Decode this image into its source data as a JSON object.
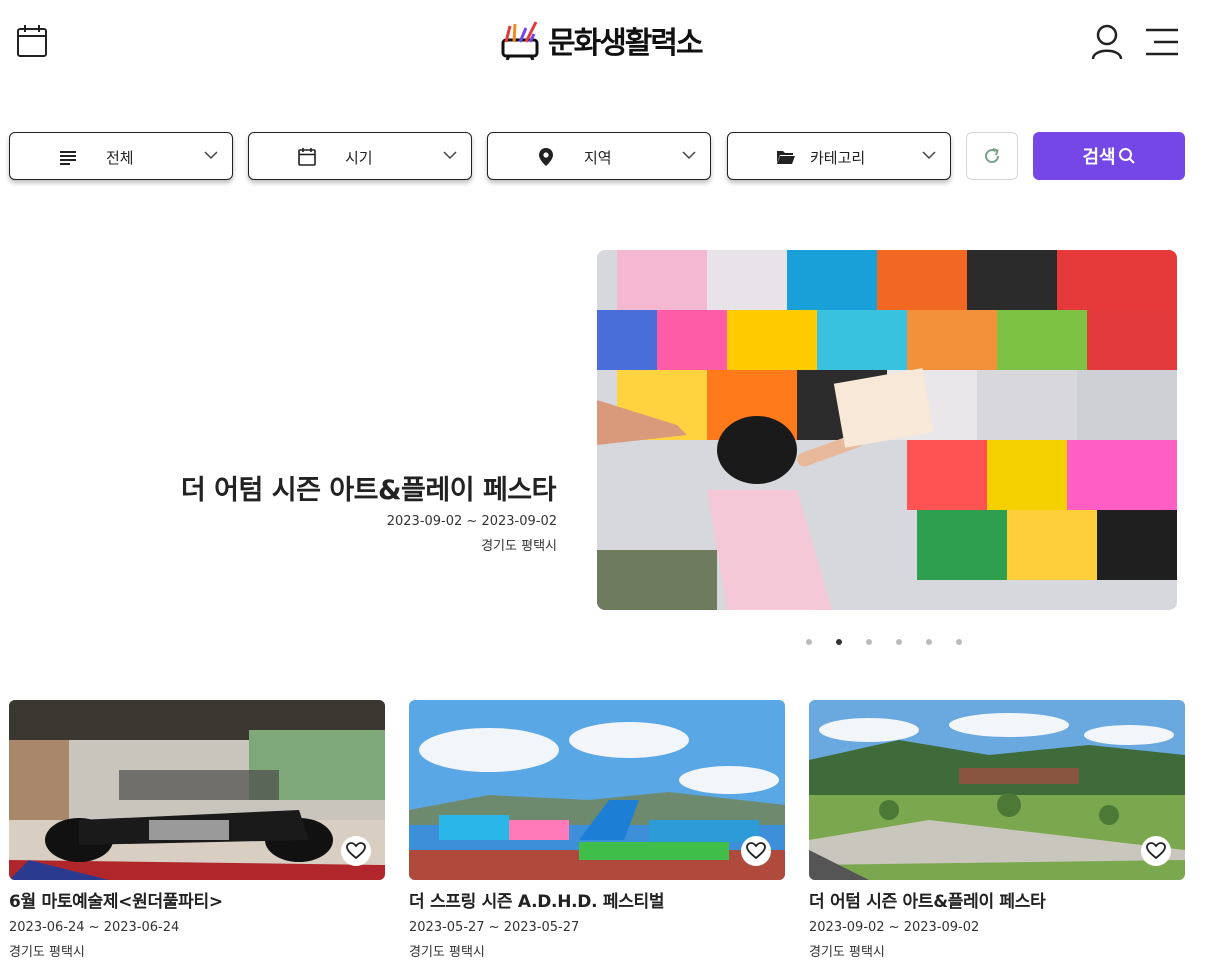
{
  "header": {
    "logo_text": "문화생활력소",
    "colors": {
      "logo_purple": "#7447e6",
      "logo_orange": "#f08a24",
      "logo_red": "#e33b3b"
    }
  },
  "filters": [
    {
      "label": "전체",
      "icon": "list-icon"
    },
    {
      "label": "시기",
      "icon": "calendar-icon"
    },
    {
      "label": "지역",
      "icon": "location-pin-icon"
    },
    {
      "label": "카테고리",
      "icon": "folder-icon"
    }
  ],
  "search": {
    "label": "검색",
    "icon": "search-icon",
    "color": "#7447e6"
  },
  "hero": {
    "title": "더 어텀 시즌 아트&플레이 페스타",
    "date": "2023-09-02 ~ 2023-09-02",
    "location": "경기도 평택시",
    "slide_count": 6,
    "active_slide": 2
  },
  "cards": [
    {
      "title": "6월 마토예술제<원더풀파티>",
      "date": "2023-06-24 ~ 2023-06-24",
      "location": "경기도 평택시"
    },
    {
      "title": "더 스프링 시즌 A.D.H.D. 페스티벌",
      "date": "2023-05-27 ~ 2023-05-27",
      "location": "경기도 평택시"
    },
    {
      "title": "더 어텀 시즌 아트&플레이 페스타",
      "date": "2023-09-02 ~ 2023-09-02",
      "location": "경기도 평택시"
    }
  ]
}
